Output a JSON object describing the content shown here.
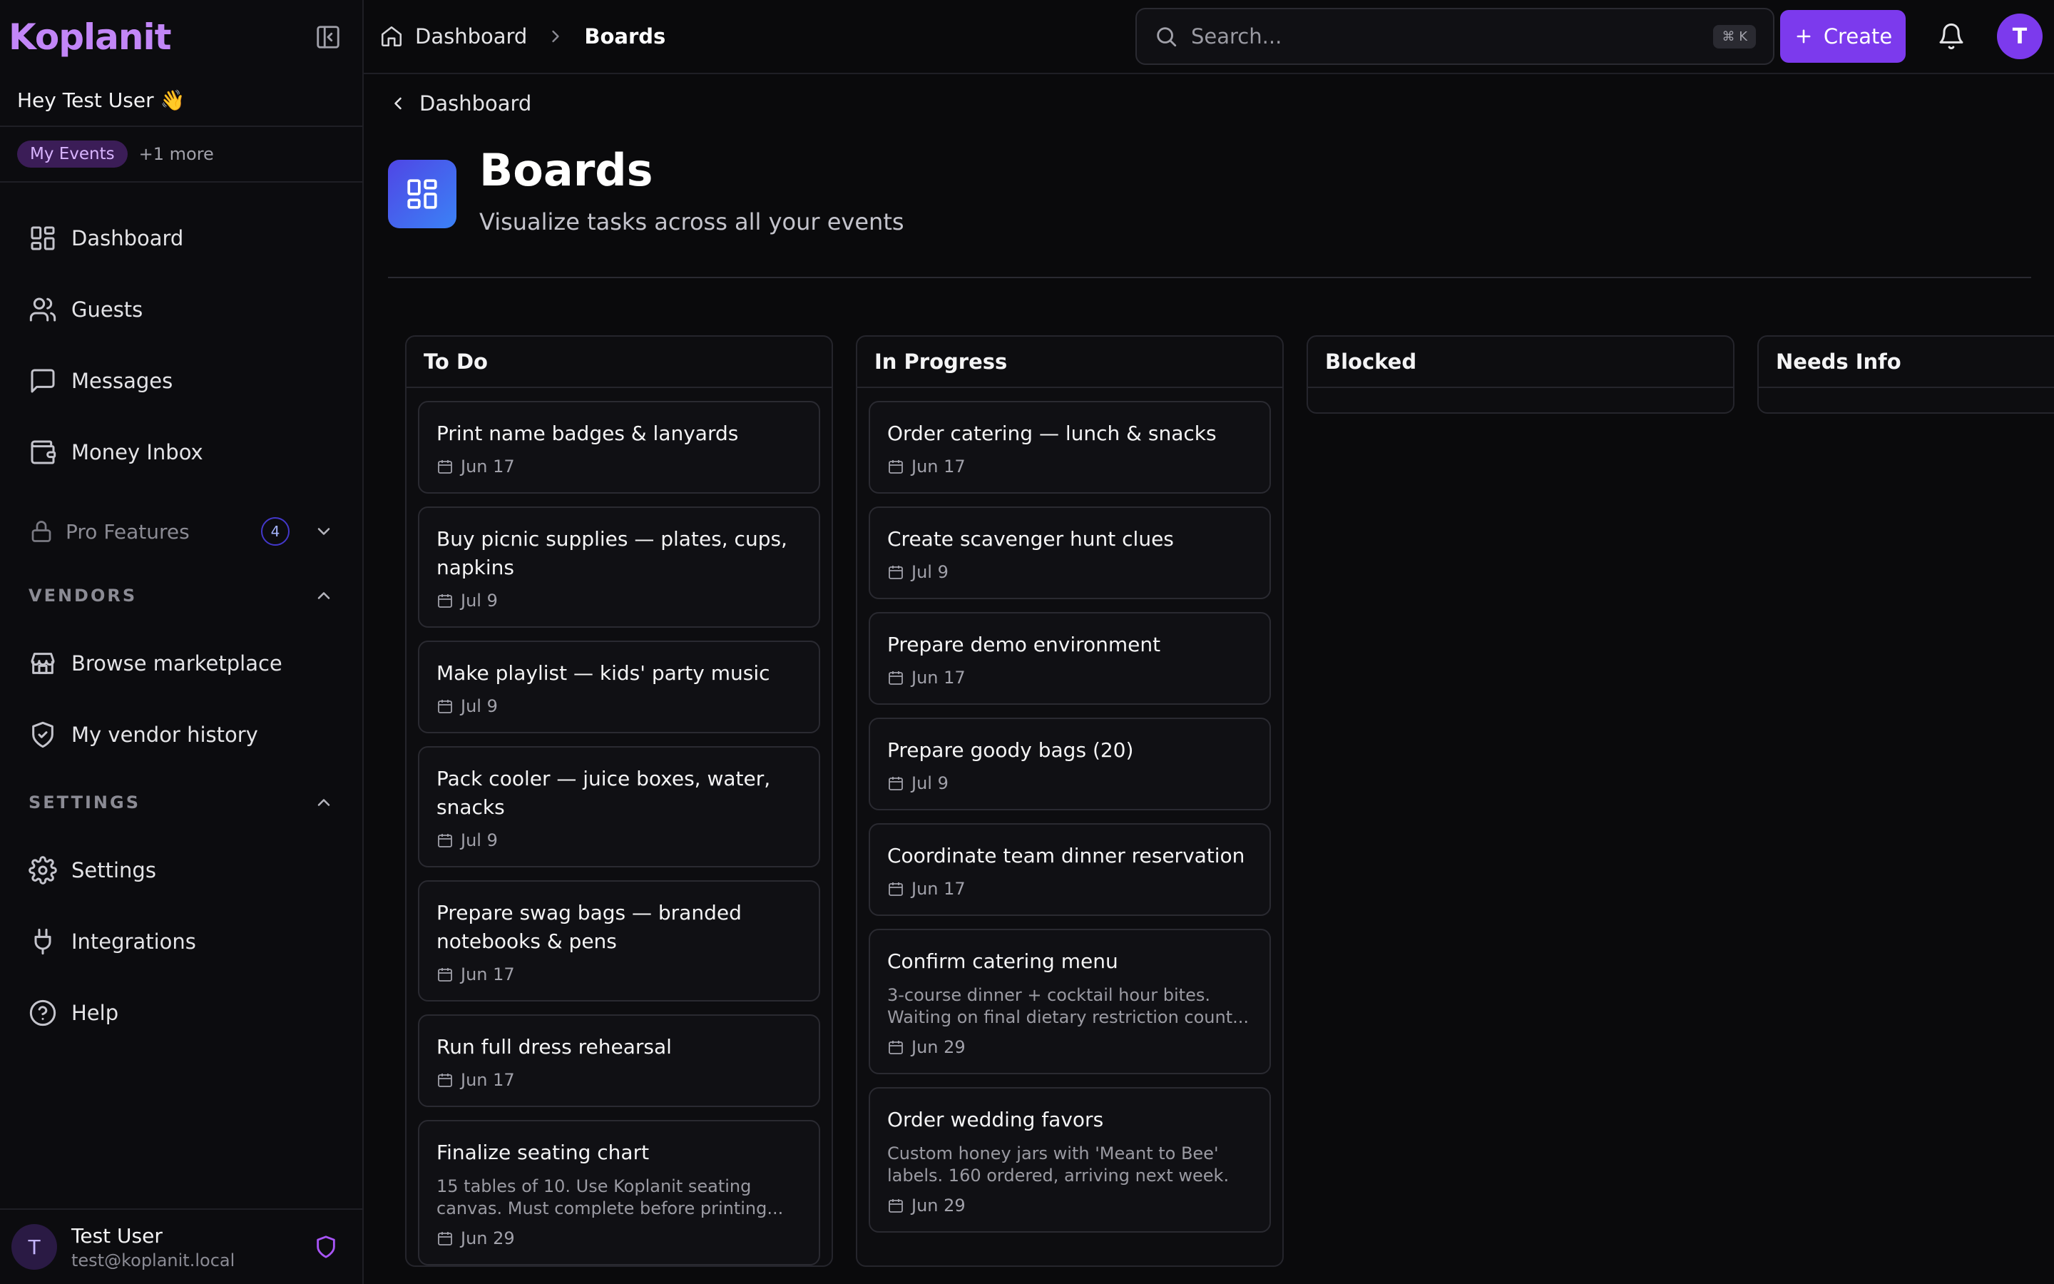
{
  "app": {
    "logo_text": "Koplanit",
    "brand_color": "#c286f7",
    "accent_color": "#7c3aed"
  },
  "sidebar": {
    "greeting": "Hey Test User 👋",
    "event_chip": "My Events",
    "event_more": "+1 more",
    "nav": [
      {
        "label": "Dashboard",
        "icon": "dashboard-icon"
      },
      {
        "label": "Guests",
        "icon": "users-icon"
      },
      {
        "label": "Messages",
        "icon": "message-icon"
      },
      {
        "label": "Money Inbox",
        "icon": "wallet-icon"
      }
    ],
    "pro": {
      "label": "Pro Features",
      "badge": "4"
    },
    "vendors": {
      "heading": "VENDORS",
      "items": [
        {
          "label": "Browse marketplace",
          "icon": "store-icon"
        },
        {
          "label": "My vendor history",
          "icon": "shield-check-icon"
        }
      ]
    },
    "settings": {
      "heading": "SETTINGS",
      "items": [
        {
          "label": "Settings",
          "icon": "gear-icon"
        },
        {
          "label": "Integrations",
          "icon": "plug-icon"
        },
        {
          "label": "Help",
          "icon": "help-icon"
        }
      ]
    },
    "user": {
      "initial": "T",
      "name": "Test User",
      "email": "test@koplanit.local"
    }
  },
  "topbar": {
    "breadcrumb": [
      "Dashboard",
      "Boards"
    ],
    "search_placeholder": "Search...",
    "search_shortcut": "⌘ K",
    "create_label": "Create",
    "avatar_initial": "T"
  },
  "page": {
    "back_label": "Dashboard",
    "title": "Boards",
    "subtitle": "Visualize tasks across all your events"
  },
  "board": {
    "columns": [
      {
        "name": "To Do",
        "cards": [
          {
            "title": "Print name badges & lanyards",
            "desc": "",
            "date": "Jun 17"
          },
          {
            "title": "Buy picnic supplies — plates, cups, napkins",
            "desc": "",
            "date": "Jul 9"
          },
          {
            "title": "Make playlist — kids' party music",
            "desc": "",
            "date": "Jul 9"
          },
          {
            "title": "Pack cooler — juice boxes, water, snacks",
            "desc": "",
            "date": "Jul 9"
          },
          {
            "title": "Prepare swag bags — branded notebooks & pens",
            "desc": "",
            "date": "Jun 17"
          },
          {
            "title": "Run full dress rehearsal",
            "desc": "",
            "date": "Jun 17"
          },
          {
            "title": "Finalize seating chart",
            "desc": "15 tables of 10. Use Koplanit seating canvas. Must complete before printing...",
            "date": "Jun 29"
          }
        ]
      },
      {
        "name": "In Progress",
        "cards": [
          {
            "title": "Order catering — lunch & snacks",
            "desc": "",
            "date": "Jun 17"
          },
          {
            "title": "Create scavenger hunt clues",
            "desc": "",
            "date": "Jul 9"
          },
          {
            "title": "Prepare demo environment",
            "desc": "",
            "date": "Jun 17"
          },
          {
            "title": "Prepare goody bags (20)",
            "desc": "",
            "date": "Jul 9"
          },
          {
            "title": "Coordinate team dinner reservation",
            "desc": "",
            "date": "Jun 17"
          },
          {
            "title": "Confirm catering menu",
            "desc": "3-course dinner + cocktail hour bites. Waiting on final dietary restriction count...",
            "date": "Jun 29"
          },
          {
            "title": "Order wedding favors",
            "desc": "Custom honey jars with 'Meant to Bee' labels. 160 ordered, arriving next week.",
            "date": "Jun 29"
          }
        ]
      },
      {
        "name": "Blocked",
        "cards": []
      },
      {
        "name": "Needs Info",
        "cards": []
      }
    ]
  }
}
